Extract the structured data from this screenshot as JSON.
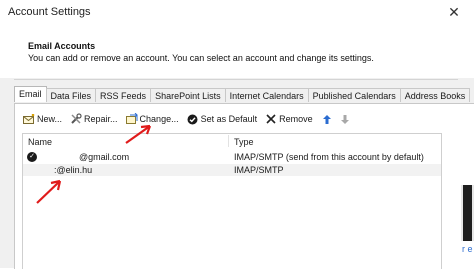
{
  "window": {
    "title": "Account Settings",
    "close_glyph": "✕"
  },
  "header": {
    "title": "Email Accounts",
    "description": "You can add or remove an account. You can select an account and change its settings."
  },
  "tabs": [
    {
      "label": "Email",
      "active": true
    },
    {
      "label": "Data Files"
    },
    {
      "label": "RSS Feeds"
    },
    {
      "label": "SharePoint Lists"
    },
    {
      "label": "Internet Calendars"
    },
    {
      "label": "Published Calendars"
    },
    {
      "label": "Address Books"
    }
  ],
  "toolbar": {
    "new_label": "New...",
    "repair_label": "Repair...",
    "change_label": "Change...",
    "default_label": "Set as Default",
    "remove_label": "Remove",
    "new_icon": "new-email-icon",
    "repair_icon": "repair-tools-icon",
    "change_icon": "change-settings-icon",
    "default_icon": "checkmark-circle-icon",
    "remove_icon": "x-remove-icon",
    "up_icon": "move-up-arrow-icon",
    "down_icon": "move-down-arrow-icon"
  },
  "list": {
    "columns": {
      "name": "Name",
      "type": "Type"
    },
    "rows": [
      {
        "name": "@gmail.com",
        "type": "IMAP/SMTP (send from this account by default)",
        "default": true
      },
      {
        "name": ":@elin.hu",
        "type": "IMAP/SMTP",
        "default": false
      }
    ]
  },
  "colors": {
    "annotation_red": "#e01b1b",
    "accent_blue": "#2b6cd0"
  },
  "right_edge_text": "r e"
}
